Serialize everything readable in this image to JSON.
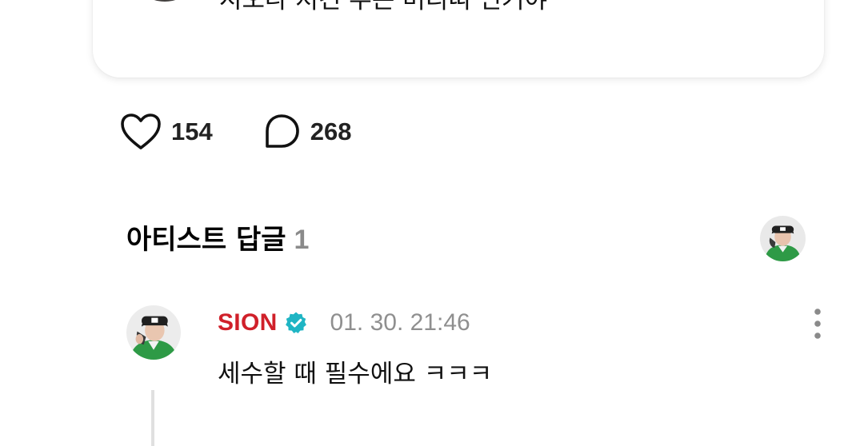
{
  "post": {
    "text": "시오나 저건 무슨 머리띠 인거야"
  },
  "actions": {
    "like_count": "154",
    "comment_count": "268"
  },
  "artist_replies": {
    "title": "아티스트 답글",
    "count": "1"
  },
  "reply": {
    "author": "SION",
    "timestamp": "01. 30. 21:46",
    "text": "세수할 때 필수에요 ㅋㅋㅋ"
  },
  "colors": {
    "author_red": "#d0202a",
    "verified_teal": "#1fb5c4",
    "muted_gray": "#8a8a8a",
    "avatar_green": "#2e9a46"
  },
  "icons": {
    "like": "heart-icon",
    "comment": "speech-bubble-icon",
    "verified": "verified-badge-icon",
    "more": "more-vertical-icon"
  }
}
